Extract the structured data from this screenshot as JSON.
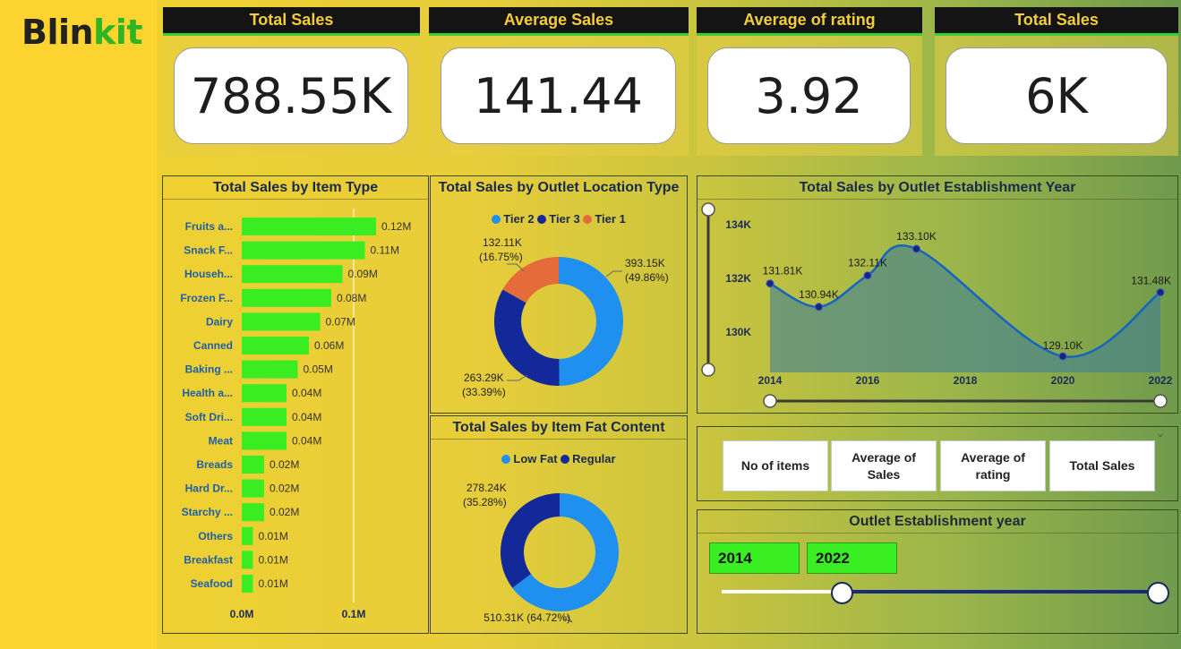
{
  "brand": {
    "part1": "Blin",
    "part2": "kit"
  },
  "kpis": [
    {
      "title": "Total Sales",
      "value": "788.55K"
    },
    {
      "title": "Average Sales",
      "value": "141.44"
    },
    {
      "title": "Average of rating",
      "value": "3.92"
    },
    {
      "title": "Total Sales",
      "value": "6K"
    }
  ],
  "item_type_chart": {
    "title": "Total Sales by Item Type",
    "categories": [
      "Fruits a...",
      "Snack F...",
      "Househ...",
      "Frozen F...",
      "Dairy",
      "Canned",
      "Baking ...",
      "Health a...",
      "Soft Dri...",
      "Meat",
      "Breads",
      "Hard Dr...",
      "Starchy ...",
      "Others",
      "Breakfast",
      "Seafood"
    ],
    "values": [
      0.12,
      0.11,
      0.09,
      0.08,
      0.07,
      0.06,
      0.05,
      0.04,
      0.04,
      0.04,
      0.02,
      0.02,
      0.02,
      0.01,
      0.01,
      0.01
    ],
    "value_labels": [
      "0.12M",
      "0.11M",
      "0.09M",
      "0.08M",
      "0.07M",
      "0.06M",
      "0.05M",
      "0.04M",
      "0.04M",
      "0.04M",
      "0.02M",
      "0.02M",
      "0.02M",
      "0.01M",
      "0.01M",
      "0.01M"
    ],
    "ticks": [
      "0.0M",
      "0.1M"
    ],
    "bar_color": "#3aec22"
  },
  "location_chart": {
    "title": "Total Sales by Outlet Location Type",
    "legend": [
      "Tier 2",
      "Tier 3",
      "Tier 1"
    ],
    "colors": [
      "#1f8ff0",
      "#13299a",
      "#e56b3a"
    ],
    "values": [
      393.15,
      263.29,
      132.11
    ],
    "labels": [
      [
        "393.15K",
        "(49.86%)"
      ],
      [
        "263.29K",
        "(33.39%)"
      ],
      [
        "132.11K",
        "(16.75%)"
      ]
    ]
  },
  "fat_chart": {
    "title": "Total Sales by Item Fat Content",
    "legend": [
      "Low Fat",
      "Regular"
    ],
    "colors": [
      "#1f8ff0",
      "#13299a"
    ],
    "values": [
      510.31,
      278.24
    ],
    "labels": [
      "510.31K (64.72%)",
      "278.24K",
      "(35.28%)"
    ]
  },
  "chart_data": {
    "type": "area",
    "title": "Total Sales by Outlet Establishment Year",
    "x": [
      2014,
      2015,
      2016,
      2017,
      2020,
      2022
    ],
    "values": [
      131.81,
      130.94,
      132.11,
      133.1,
      129.1,
      131.48
    ],
    "point_labels": [
      "131.81K",
      "130.94K",
      "132.11K",
      "133.10K",
      "129.10K",
      "131.48K"
    ],
    "x_ticks": [
      "2014",
      "2016",
      "2018",
      "2020",
      "2022"
    ],
    "y_ticks": [
      "130K",
      "132K",
      "134K"
    ],
    "xlim": [
      2014,
      2022
    ],
    "ylim": [
      128.5,
      134.6
    ],
    "line_color": "#1565c0"
  },
  "metric_buttons": [
    {
      "label": "No of items"
    },
    {
      "label": "Average of Sales"
    },
    {
      "label": "Average of rating"
    },
    {
      "label": "Total Sales"
    }
  ],
  "year_slicer": {
    "title": "Outlet Establishment year",
    "start": "2014",
    "end": "2022"
  }
}
